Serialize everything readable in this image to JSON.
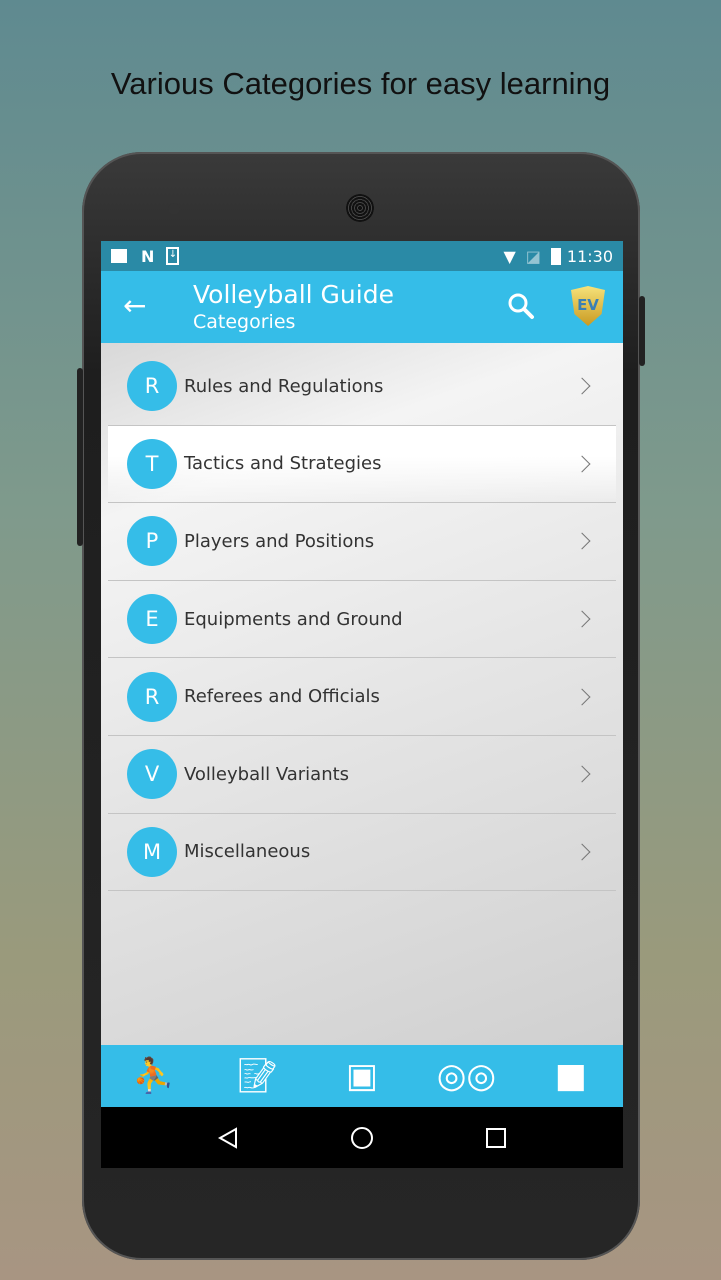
{
  "headline": "Various Categories for easy learning",
  "status": {
    "time": "11:30",
    "icons": [
      "image-icon",
      "n-icon",
      "download-icon",
      "wifi-icon",
      "no-sim-icon",
      "battery-charging-icon"
    ]
  },
  "appbar": {
    "title": "Volleyball Guide",
    "subtitle": "Categories",
    "logo": "EV"
  },
  "categories": [
    {
      "letter": "R",
      "label": "Rules and Regulations"
    },
    {
      "letter": "T",
      "label": "Tactics and Strategies"
    },
    {
      "letter": "P",
      "label": "Players and Positions"
    },
    {
      "letter": "E",
      "label": "Equipments and Ground"
    },
    {
      "letter": "R",
      "label": "Referees and Officials"
    },
    {
      "letter": "V",
      "label": "Volleyball Variants"
    },
    {
      "letter": "M",
      "label": "Miscellaneous"
    }
  ],
  "bottom_nav": [
    "volleyball-player-icon",
    "notes-edit-icon",
    "box-download-icon",
    "owl-icon",
    "puzzle-icon"
  ],
  "colors": {
    "accent": "#35bde8",
    "status": "#2a8aa6"
  }
}
